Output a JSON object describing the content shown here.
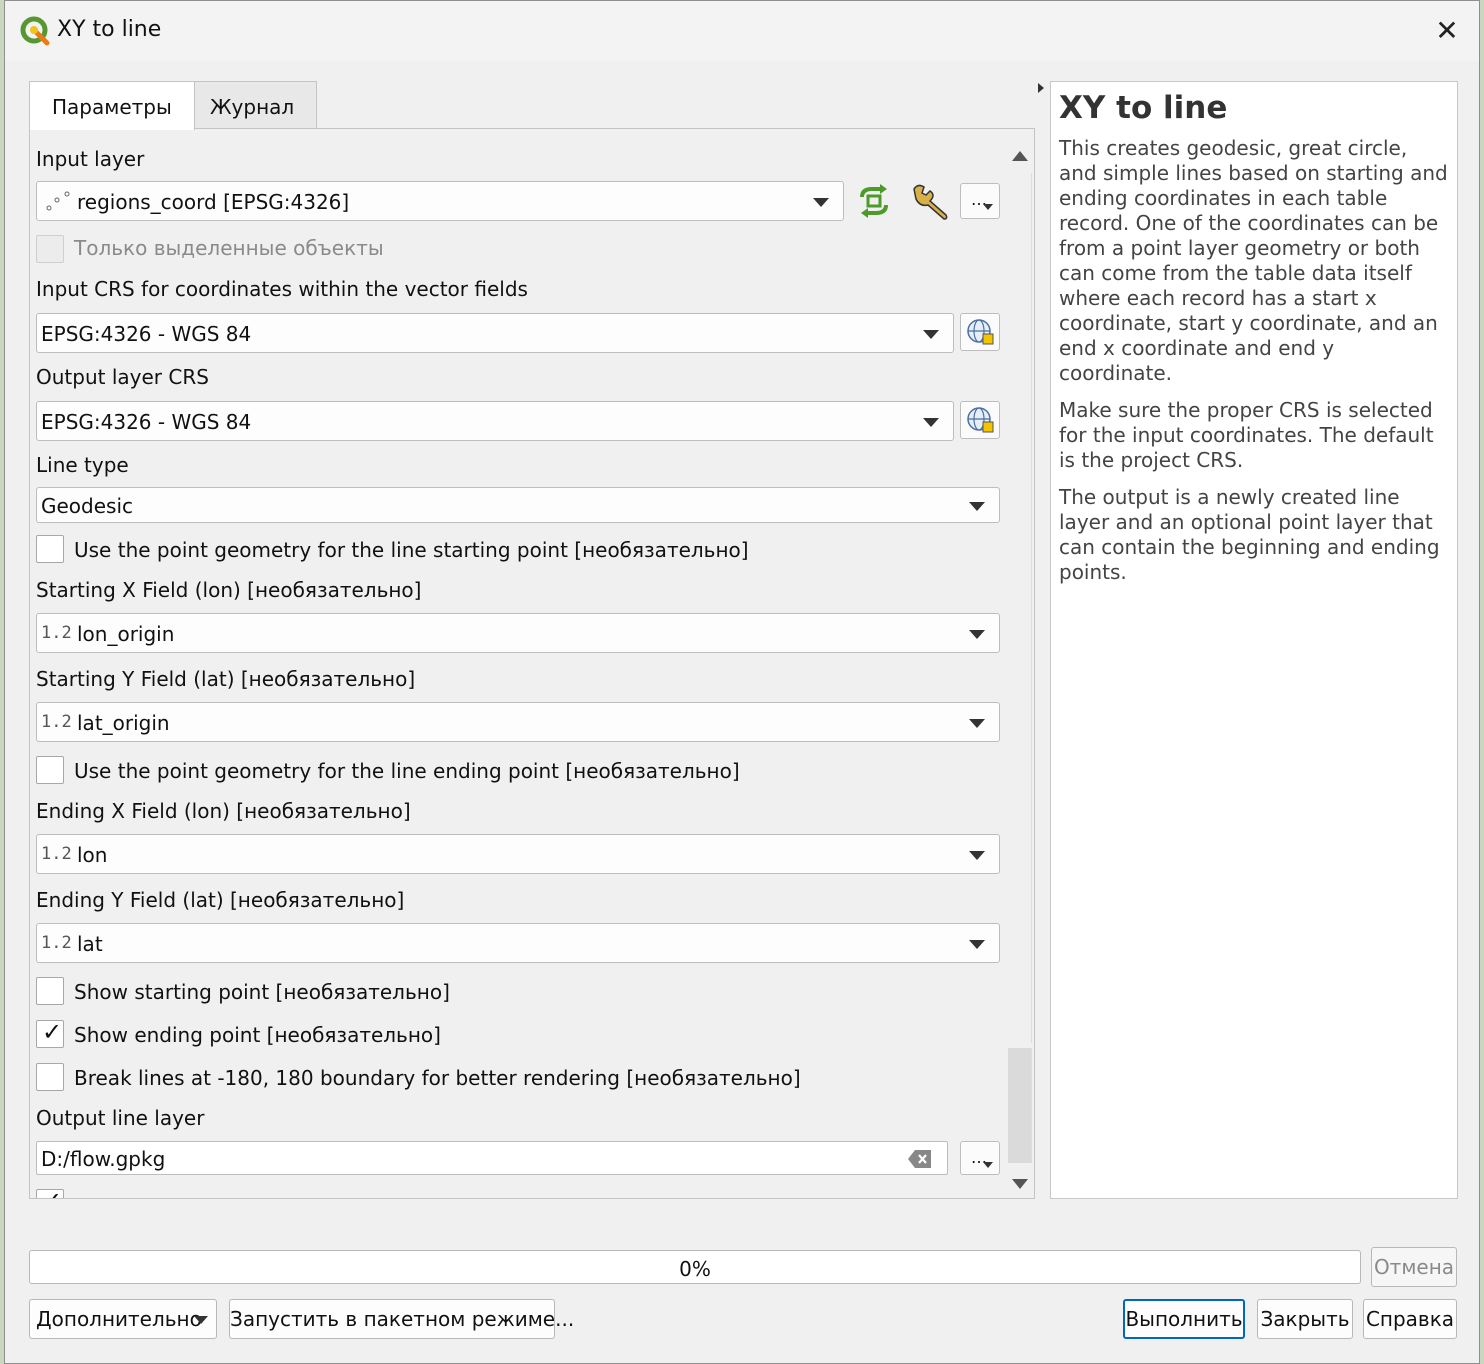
{
  "window": {
    "title": "XY to line",
    "close_glyph": "✕"
  },
  "tabs": [
    {
      "label": "Параметры",
      "active": true
    },
    {
      "label": "Журнал",
      "active": false
    }
  ],
  "form": {
    "input_layer": {
      "label": "Input layer",
      "value": "regions_coord [EPSG:4326]",
      "icon": "point-layer-icon"
    },
    "selected_only": {
      "label": "Только выделенные объекты",
      "checked": false,
      "enabled": false
    },
    "input_crs": {
      "label": "Input CRS for coordinates within the vector fields",
      "value": "EPSG:4326 - WGS 84"
    },
    "output_crs": {
      "label": "Output layer CRS",
      "value": "EPSG:4326 - WGS 84"
    },
    "line_type": {
      "label": "Line type",
      "value": "Geodesic"
    },
    "use_start_geom": {
      "label": "Use the point geometry for the line starting point [необязательно]",
      "checked": false
    },
    "start_x": {
      "label": "Starting X Field (lon) [необязательно]",
      "type_badge": "1.2",
      "value": "lon_origin"
    },
    "start_y": {
      "label": "Starting Y Field (lat) [необязательно]",
      "type_badge": "1.2",
      "value": "lat_origin"
    },
    "use_end_geom": {
      "label": "Use the point geometry for the line ending point [необязательно]",
      "checked": false
    },
    "end_x": {
      "label": "Ending X Field (lon) [необязательно]",
      "type_badge": "1.2",
      "value": "lon"
    },
    "end_y": {
      "label": "Ending Y Field (lat) [необязательно]",
      "type_badge": "1.2",
      "value": "lat"
    },
    "show_start": {
      "label": "Show starting point [необязательно]",
      "checked": false
    },
    "show_end": {
      "label": "Show ending point [необязательно]",
      "checked": true
    },
    "break_lines": {
      "label": "Break lines at -180, 180 boundary for better rendering [необязательно]",
      "checked": false
    },
    "output_line": {
      "label": "Output line layer",
      "value": "D:/flow.gpkg"
    },
    "more_button": "…"
  },
  "help": {
    "title": "XY to line",
    "paragraphs": [
      "This creates geodesic, great circle, and simple lines based on starting and ending coordinates in each table record. One of the coordinates can be from a point layer geometry or both can come from the table data itself where each record has a start x coordinate, start y coordinate, and an end x coordinate and end y coordinate.",
      "Make sure the proper CRS is selected for the input coordinates. The default is the project CRS.",
      "The output is a newly created line layer and an optional point layer that can contain the beginning and ending points."
    ]
  },
  "footer": {
    "progress_text": "0%",
    "progress_value": 0,
    "cancel_label": "Отмена",
    "advanced_label": "Дополнительно",
    "batch_label": "Запустить в пакетном режиме...",
    "run_label": "Выполнить",
    "close_label": "Закрыть",
    "help_label": "Справка"
  }
}
